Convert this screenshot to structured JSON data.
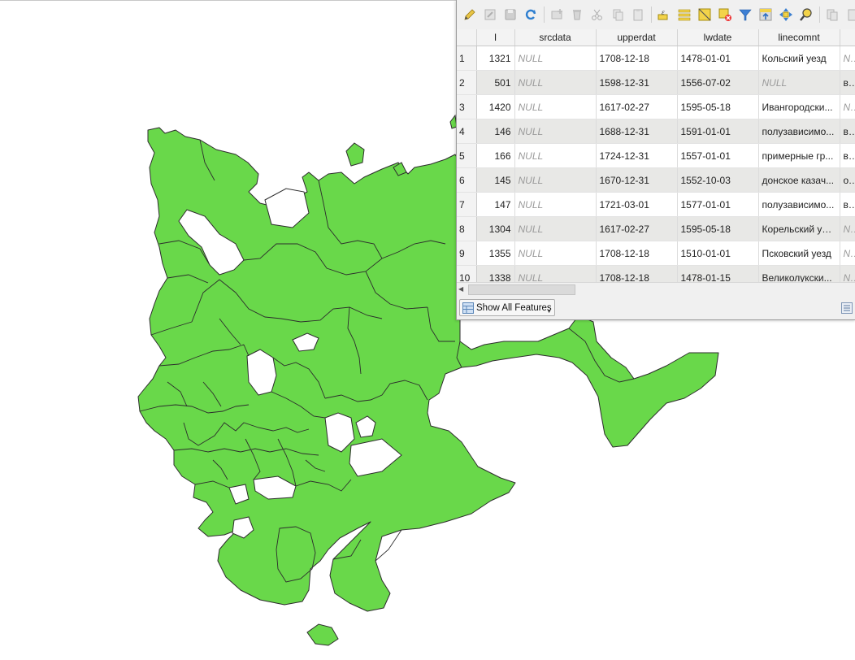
{
  "map": {
    "fill_color": "#69d84a",
    "stroke_color": "#2c2c2c",
    "background": "#ffffff"
  },
  "attribute_table": {
    "toolbar_icons": [
      "toggle-editing-icon",
      "multi-edit-icon",
      "save-edits-icon",
      "reload-icon",
      "add-feature-icon",
      "delete-feature-icon",
      "cut-icon",
      "copy-icon",
      "paste-icon",
      "expression-select-icon",
      "select-all-icon",
      "invert-selection-icon",
      "deselect-icon",
      "filter-icon",
      "move-selection-top-icon",
      "pan-to-selection-icon",
      "zoom-to-selection-icon",
      "copy-cells-icon",
      "delete-column-icon"
    ],
    "columns": [
      "I",
      "srcdata",
      "upperdat",
      "lwdate",
      "linecomnt",
      ""
    ],
    "rows": [
      {
        "n": "1",
        "id": "1321",
        "srcdata": "NULL",
        "upperdat": "1708-12-18",
        "lwdate": "1478-01-01",
        "linecomnt": "Кольский уезд",
        "extra": "NUL"
      },
      {
        "n": "2",
        "id": "501",
        "srcdata": "NULL",
        "upperdat": "1598-12-31",
        "lwdate": "1556-07-02",
        "linecomnt": "NULL",
        "extra": "взя"
      },
      {
        "n": "3",
        "id": "1420",
        "srcdata": "NULL",
        "upperdat": "1617-02-27",
        "lwdate": "1595-05-18",
        "linecomnt": "Ивангородски...",
        "extra": "NUL"
      },
      {
        "n": "4",
        "id": "146",
        "srcdata": "NULL",
        "upperdat": "1688-12-31",
        "lwdate": "1591-01-01",
        "linecomnt": "полузависимо...",
        "extra": "впе"
      },
      {
        "n": "5",
        "id": "166",
        "srcdata": "NULL",
        "upperdat": "1724-12-31",
        "lwdate": "1557-01-01",
        "linecomnt": "примерные гр...",
        "extra": "выд"
      },
      {
        "n": "6",
        "id": "145",
        "srcdata": "NULL",
        "upperdat": "1670-12-31",
        "lwdate": "1552-10-03",
        "linecomnt": "донское казач...",
        "extra": "оче"
      },
      {
        "n": "7",
        "id": "147",
        "srcdata": "NULL",
        "upperdat": "1721-03-01",
        "lwdate": "1577-01-01",
        "linecomnt": "полузависимо...",
        "extra": "воз"
      },
      {
        "n": "8",
        "id": "1304",
        "srcdata": "NULL",
        "upperdat": "1617-02-27",
        "lwdate": "1595-05-18",
        "linecomnt": "Корельский уезд",
        "extra": "NUL"
      },
      {
        "n": "9",
        "id": "1355",
        "srcdata": "NULL",
        "upperdat": "1708-12-18",
        "lwdate": "1510-01-01",
        "linecomnt": "Псковский уезд",
        "extra": "NUL"
      },
      {
        "n": "10",
        "id": "1338",
        "srcdata": "NULL",
        "upperdat": "1708-12-18",
        "lwdate": "1478-01-15",
        "linecomnt": "Великолукски...",
        "extra": "NUL"
      }
    ],
    "show_all_features": "Show All Features"
  }
}
